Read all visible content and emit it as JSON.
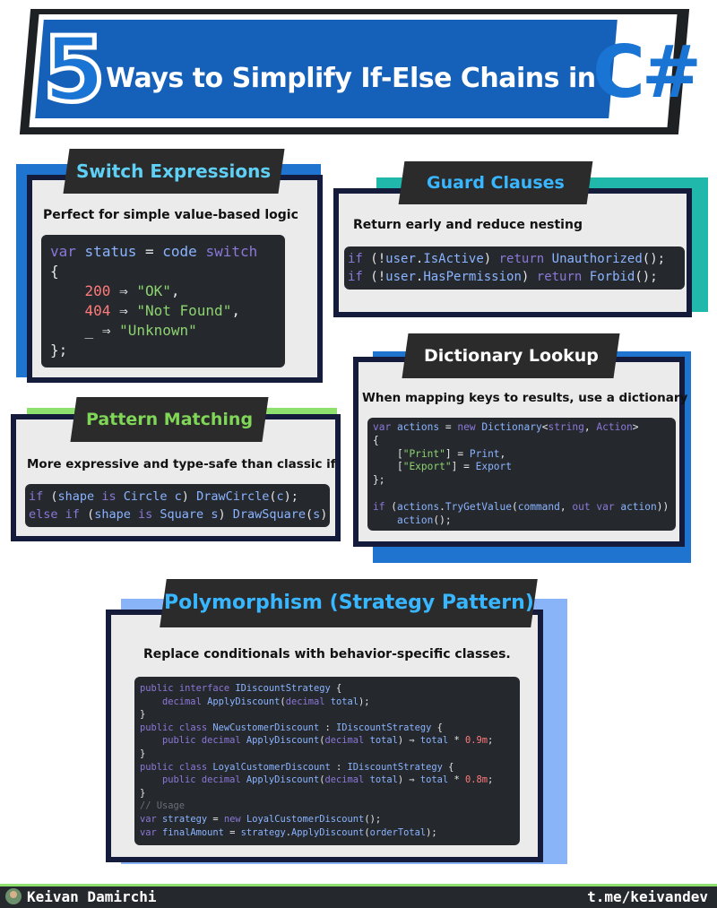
{
  "header": {
    "number": "5",
    "title": "Ways to Simplify If-Else Chains in",
    "language": "C#"
  },
  "switch": {
    "title": "Switch Expressions",
    "subtitle": "Perfect for simple value-based logic",
    "code": [
      "var status = code switch",
      "{",
      "    200 ⇒ \"OK\",",
      "    404 ⇒ \"Not Found\",",
      "    _ ⇒ \"Unknown\"",
      "};"
    ]
  },
  "guard": {
    "title": "Guard Clauses",
    "subtitle": "Return early and reduce nesting",
    "code": [
      "if (!user.IsActive) return Unauthorized();",
      "if (!user.HasPermission) return Forbid();"
    ]
  },
  "pattern": {
    "title": "Pattern Matching",
    "subtitle": "More expressive and type-safe than classic if",
    "code": [
      "if (shape is Circle c) DrawCircle(c);",
      "else if (shape is Square s) DrawSquare(s);"
    ]
  },
  "dictionary": {
    "title": "Dictionary Lookup",
    "subtitle": "When mapping keys to results, use a dictionary",
    "code": [
      "var actions = new Dictionary<string, Action>",
      "{",
      "    [\"Print\"] = Print,",
      "    [\"Export\"] = Export",
      "};",
      "",
      "if (actions.TryGetValue(command, out var action))",
      "    action();"
    ]
  },
  "polymorphism": {
    "title": "Polymorphism (Strategy Pattern)",
    "subtitle": "Replace conditionals with behavior-specific classes.",
    "code": [
      "public interface IDiscountStrategy {",
      "    decimal ApplyDiscount(decimal total);",
      "}",
      "public class NewCustomerDiscount : IDiscountStrategy {",
      "    public decimal ApplyDiscount(decimal total) ⇒ total * 0.9m;",
      "}",
      "public class LoyalCustomerDiscount : IDiscountStrategy {",
      "    public decimal ApplyDiscount(decimal total) ⇒ total * 0.8m;",
      "}",
      "// Usage",
      "var strategy = new LoyalCustomerDiscount();",
      "var finalAmount = strategy.ApplyDiscount(orderTotal);"
    ]
  },
  "footer": {
    "name": "Keivan Damirchi",
    "link": "t.me/keivandev"
  },
  "colors": {
    "brand_blue": "#1560b9",
    "card_border": "#151b3b",
    "switch_title": "#5fd0f5",
    "guard_title": "#38b6ff",
    "pattern_title": "#7fd657",
    "accent_green": "#8fe16f"
  },
  "icons": {
    "avatar": "avatar-photo"
  }
}
